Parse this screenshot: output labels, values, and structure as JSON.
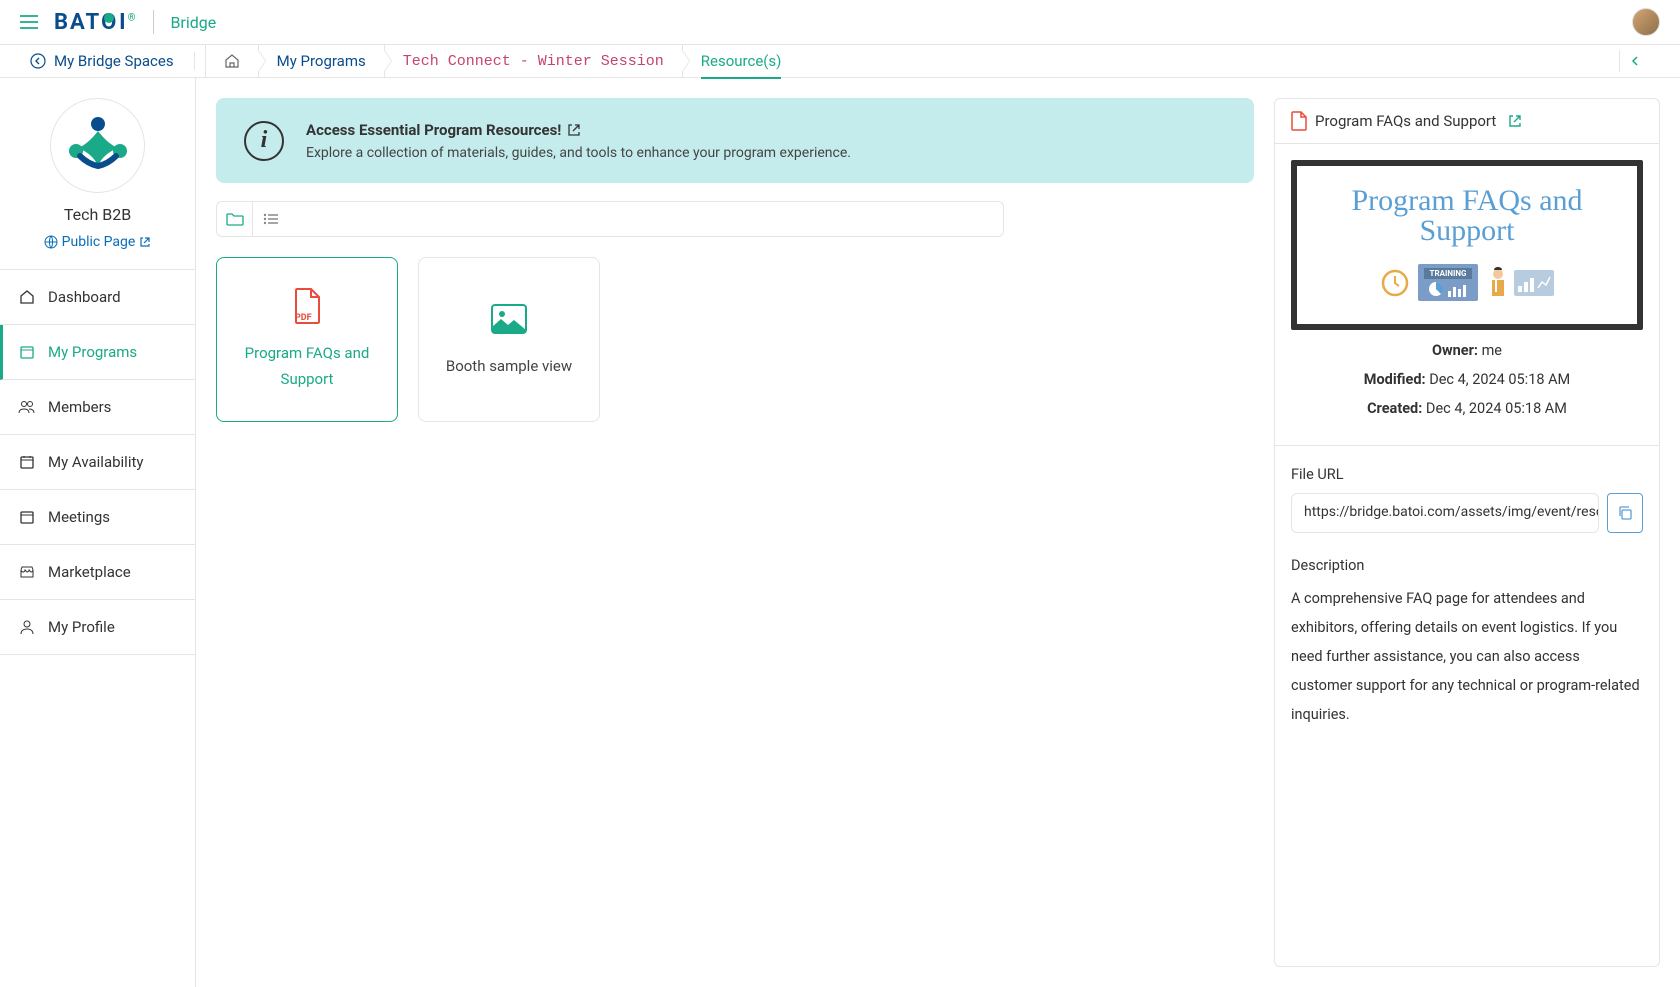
{
  "header": {
    "app_name": "Bridge",
    "logo_text": "BAT",
    "logo_accent": "I"
  },
  "breadcrumb": {
    "back_label": "My Bridge Spaces",
    "programs": "My Programs",
    "session": "Tech Connect - Winter Session",
    "resources": "Resource(s)"
  },
  "sidebar": {
    "org_name": "Tech B2B",
    "public_page": "Public Page",
    "items": [
      {
        "label": "Dashboard"
      },
      {
        "label": "My Programs"
      },
      {
        "label": "Members"
      },
      {
        "label": "My Availability"
      },
      {
        "label": "Meetings"
      },
      {
        "label": "Marketplace"
      },
      {
        "label": "My Profile"
      }
    ]
  },
  "banner": {
    "title": "Access Essential Program Resources!",
    "desc": "Explore a collection of materials, guides, and tools to enhance your program experience."
  },
  "cards": [
    {
      "title": "Program FAQs and Support",
      "type": "pdf",
      "selected": true
    },
    {
      "title": "Booth sample view",
      "type": "image",
      "selected": false
    }
  ],
  "detail": {
    "title": "Program FAQs and Support",
    "preview_title": "Program FAQs and Support",
    "preview_badge": "TRAINING",
    "owner_label": "Owner:",
    "owner": "me",
    "modified_label": "Modified:",
    "modified": "Dec 4, 2024 05:18 AM",
    "created_label": "Created:",
    "created": "Dec 4, 2024 05:18 AM",
    "url_label": "File URL",
    "url_value": "https://bridge.batoi.com/assets/img/event/resource",
    "desc_label": "Description",
    "description": "A comprehensive FAQ page for attendees and exhibitors, offering details on event logistics. If you need further assistance, you can also access customer support for any technical or program-related inquiries."
  }
}
